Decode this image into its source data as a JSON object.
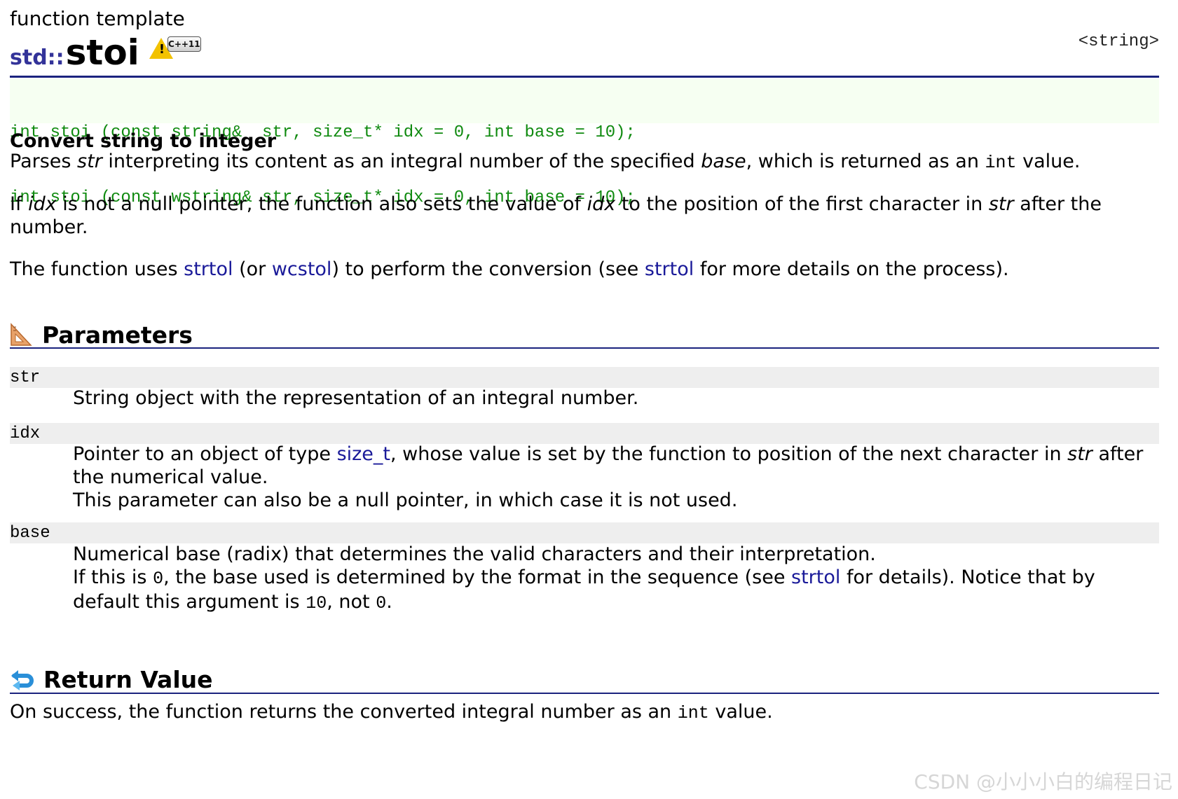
{
  "page": {
    "kind": "function template",
    "namespace": "std::",
    "function_name": "stoi",
    "badge_label": "C++11",
    "header": "<string>"
  },
  "prototypes": [
    "int stoi (const string&  str, size_t* idx = 0, int base = 10);",
    "int stoi (const wstring& str, size_t* idx = 0, int base = 10);"
  ],
  "description": {
    "headline": "Convert string to integer",
    "p1": {
      "a": "Parses ",
      "str": "str",
      "b": " interpreting its content as an integral number of the specified ",
      "base": "base",
      "c": ", which is returned as an ",
      "int": "int",
      "d": " value."
    },
    "p2": {
      "a": "If ",
      "idx": "idx",
      "b": " is not a null pointer, the function also sets the value of ",
      "idx2": "idx",
      "c": " to the position of the first character in ",
      "str": "str",
      "d": " after the number."
    },
    "p3": {
      "a": "The function uses ",
      "link1": "strtol",
      "b": " (or ",
      "link2": "wcstol",
      "c": ") to perform the conversion (see ",
      "link3": "strtol",
      "d": " for more details on the process)."
    }
  },
  "parameters": {
    "title": "Parameters",
    "str": {
      "name": "str",
      "desc": "String object with the representation of an integral number."
    },
    "idx": {
      "name": "idx",
      "a": "Pointer to an object of type ",
      "link": "size_t",
      "b": ", whose value is set by the function to position of the next character in ",
      "str": "str",
      "c": " after the numerical value.",
      "line2": "This parameter can also be a null pointer, in which case it is not used."
    },
    "base": {
      "name": "base",
      "line1": "Numerical base (radix) that determines the valid characters and their interpretation.",
      "a": "If this is ",
      "zero": "0",
      "b": ", the base used is determined by the format in the sequence (see ",
      "link": "strtol",
      "c": " for details). Notice that by default this argument is ",
      "ten": "10",
      "d": ", not ",
      "zero2": "0",
      "e": "."
    }
  },
  "return_value": {
    "title": "Return Value",
    "a": "On success, the function returns the converted integral number as an ",
    "int": "int",
    "b": " value."
  },
  "watermark": "CSDN @小小小白的编程日记",
  "colors": {
    "link": "#1a1a99",
    "namespace": "#333399",
    "prototype_text": "#0f8a0f",
    "prototype_bg": "#f6fff2",
    "rule": "#1a237e",
    "param_bg": "#eeeeee"
  },
  "icons": {
    "badge": "warning-cpp11-icon",
    "parameters": "set-square-ruler-icon",
    "return": "return-arrow-icon"
  }
}
